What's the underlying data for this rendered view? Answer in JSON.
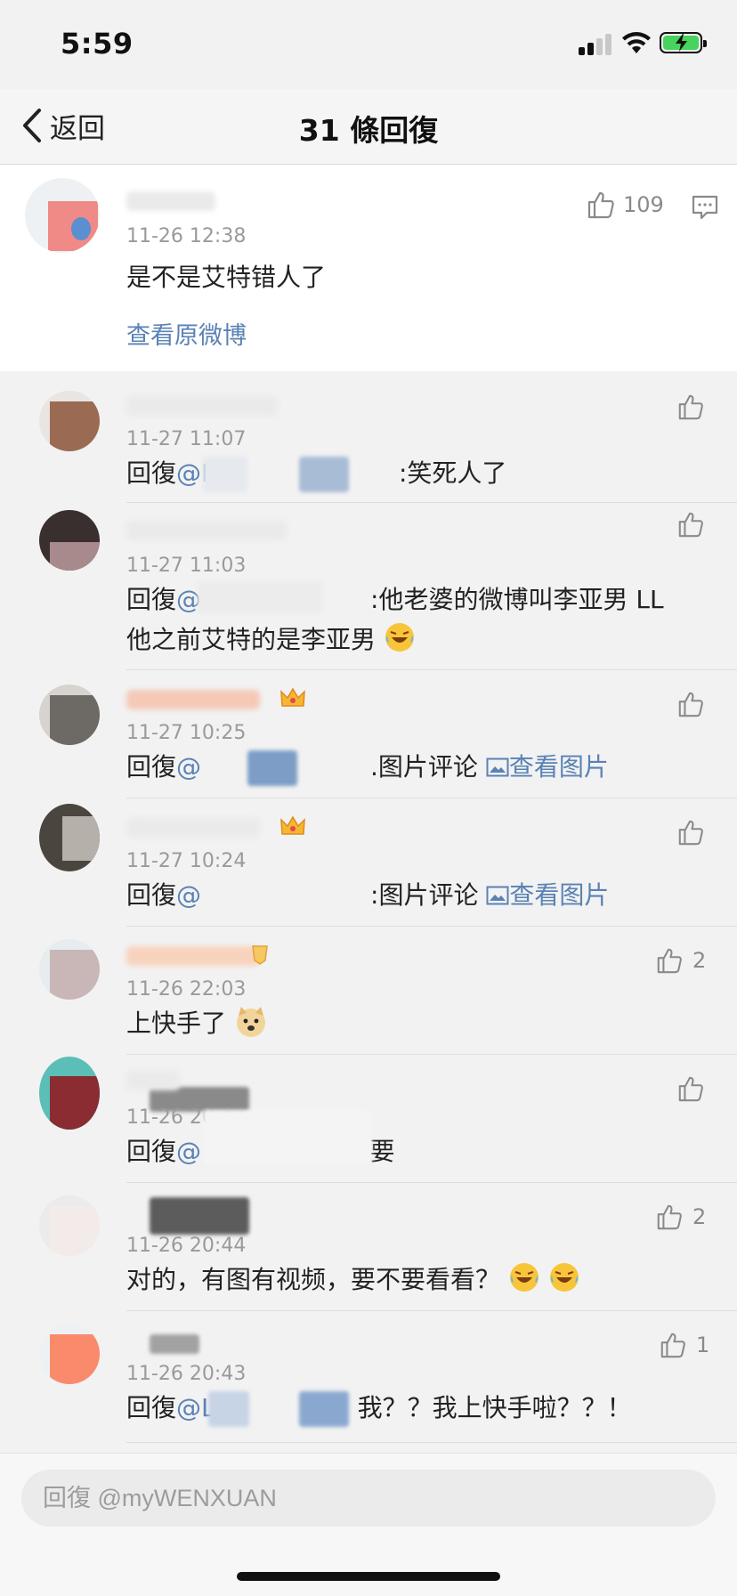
{
  "status": {
    "time": "5:59"
  },
  "nav": {
    "back_label": "返回",
    "title": "31 條回復"
  },
  "original": {
    "time": "11-26 12:38",
    "text": "是不是艾特错人了",
    "like_count": "109",
    "view_original_label": "查看原微博"
  },
  "replies": [
    {
      "time": "11-27 11:07",
      "prefix": "回復",
      "mention": "@Mi",
      "text": ":笑死人了",
      "like_count": ""
    },
    {
      "time": "11-27 11:03",
      "prefix": "回復",
      "mention": "@",
      "text": ":他老婆的微博叫李亚男 LL",
      "text2": "他之前艾特的是李亚男",
      "like_count": ""
    },
    {
      "time": "11-27 10:25",
      "prefix": "回復",
      "mention": "@",
      "text": ".图片评论",
      "view_image_label": "查看图片",
      "like_count": ""
    },
    {
      "time": "11-27 10:24",
      "prefix": "回復",
      "mention": "@",
      "text": ":图片评论",
      "view_image_label": "查看图片",
      "like_count": ""
    },
    {
      "time": "11-26 22:03",
      "text": "上快手了",
      "like_count": "2"
    },
    {
      "time": "11-26 20:44",
      "prefix": "回復",
      "mention": "@",
      "text": ":要",
      "like_count": ""
    },
    {
      "time": "11-26 20:44",
      "text": "对的，有图有视频，要不要看看？",
      "like_count": "2"
    },
    {
      "time": "11-26 20:43",
      "prefix": "回復",
      "mention": "@L",
      "text": "我？？我上快手啦？？！",
      "like_count": "1"
    }
  ],
  "input": {
    "placeholder": "回復 @myWENXUAN"
  },
  "colors": {
    "link": "#5a82b4",
    "background": "#f2f2f2",
    "card": "#ffffff",
    "battery": "#47d35d"
  }
}
